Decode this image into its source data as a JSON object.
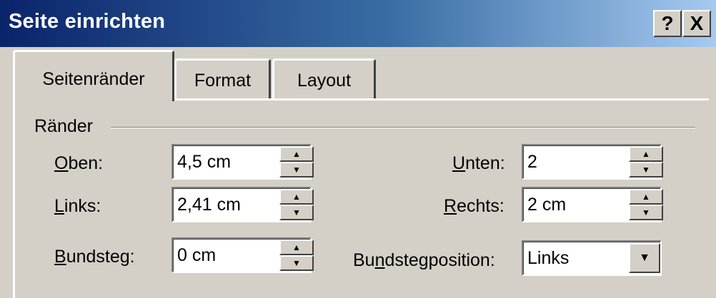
{
  "window": {
    "title": "Seite einrichten",
    "help_label": "?",
    "close_label": "X"
  },
  "tabs": [
    {
      "label": "Seitenränder",
      "active": true
    },
    {
      "label": "Format",
      "active": false
    },
    {
      "label": "Layout",
      "active": false
    }
  ],
  "group": {
    "label": "Ränder"
  },
  "fields": {
    "oben": {
      "mnemonic": "O",
      "label_rest": "ben:",
      "value": "4,5 cm"
    },
    "links": {
      "mnemonic": "L",
      "label_rest": "inks:",
      "value": "2,41 cm"
    },
    "bundsteg": {
      "mnemonic": "B",
      "label_rest": "undsteg:",
      "value": "0 cm"
    },
    "unten": {
      "mnemonic": "U",
      "label_rest": "nten:",
      "value": "2"
    },
    "rechts": {
      "mnemonic": "R",
      "label_rest": "echts:",
      "value": "2 cm"
    },
    "bundstegposition": {
      "label_pre": "Bu",
      "mnemonic": "n",
      "label_rest": "dstegposition:",
      "value": "Links"
    }
  },
  "icons": {
    "spin_up": "▲",
    "spin_down": "▼",
    "dropdown": "▼"
  }
}
